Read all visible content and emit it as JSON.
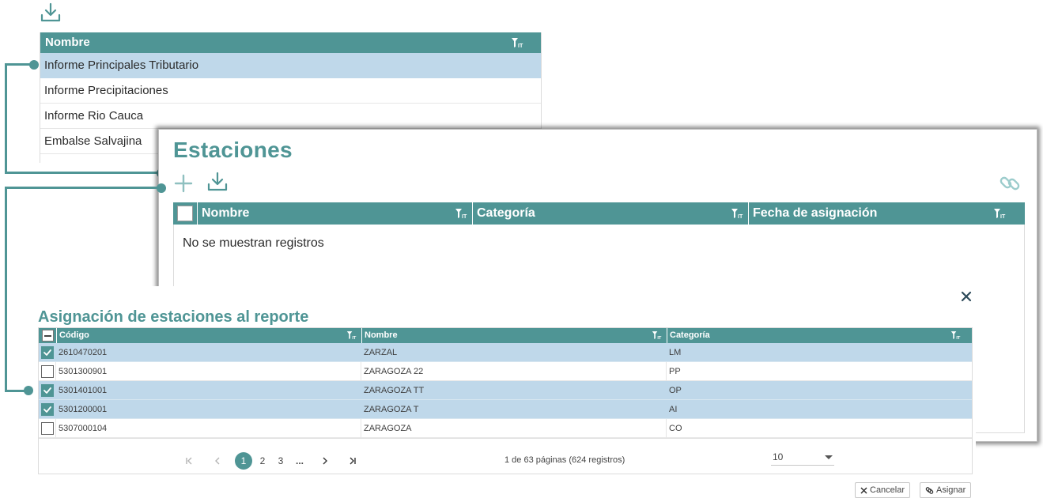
{
  "reports": {
    "header": "Nombre",
    "rows": [
      "Informe Principales Tributario",
      "Informe Precipitaciones",
      "Informe Rio Cauca",
      "Embalse Salvajina"
    ],
    "selected_index": 0
  },
  "stations": {
    "title": "Estaciones",
    "columns": [
      "Nombre",
      "Categoría",
      "Fecha de asignación"
    ],
    "empty_message": "No se muestran registros"
  },
  "assignment": {
    "title": "Asignación de estaciones al reporte",
    "columns": [
      "Código",
      "Nombre",
      "Categoría"
    ],
    "rows": [
      {
        "code": "2610470201",
        "name": "ZARZAL",
        "category": "LM",
        "checked": true
      },
      {
        "code": "5301300901",
        "name": "ZARAGOZA 22",
        "category": "PP",
        "checked": false
      },
      {
        "code": "5301401001",
        "name": "ZARAGOZA TT",
        "category": "OP",
        "checked": true
      },
      {
        "code": "5301200001",
        "name": "ZARAGOZA T",
        "category": "AI",
        "checked": true
      },
      {
        "code": "5307000104",
        "name": "ZARAGOZA",
        "category": "CO",
        "checked": false
      }
    ],
    "pager": {
      "pages": [
        "1",
        "2",
        "3",
        "..."
      ],
      "current": "1",
      "info": "1 de 63 páginas (624 registros)",
      "page_size": "10"
    },
    "cancel_label": "Cancelar",
    "assign_label": "Asignar"
  },
  "colors": {
    "accent": "#4f9595",
    "selected_row": "#bfd8ea"
  }
}
